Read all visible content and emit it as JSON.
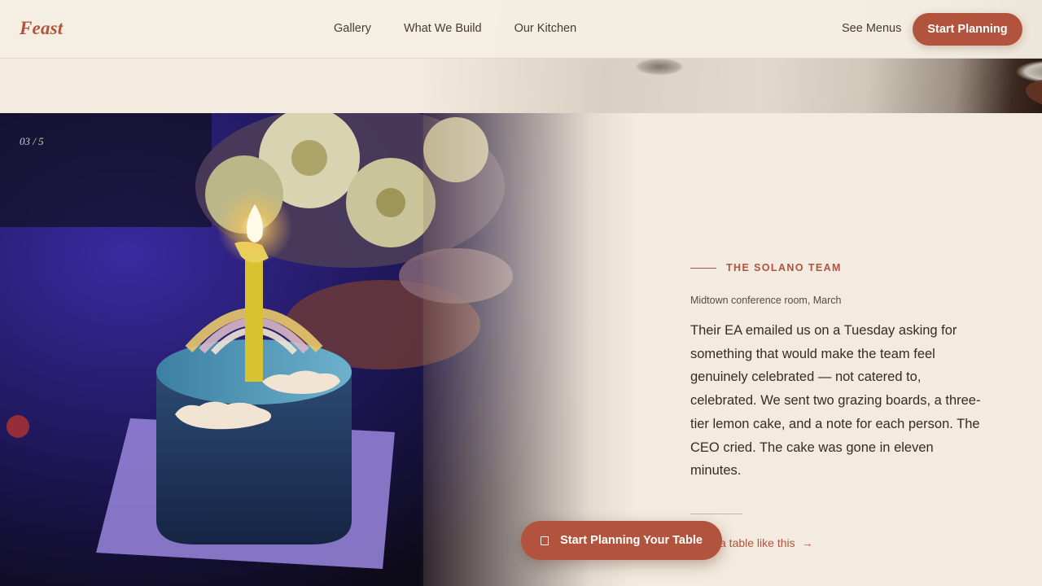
{
  "header": {
    "logo": "Feast",
    "nav": [
      "Gallery",
      "What We Build",
      "Our Kitchen"
    ],
    "see_menus": "See Menus",
    "cta": "Start Planning"
  },
  "slide": {
    "counter": "03 / 5",
    "eyebrow": "THE SOLANO TEAM",
    "meta": "Midtown conference room, March",
    "story": "Their EA emailed us on a Tuesday asking for something that would make the team feel genuinely celebrated — not catered to, celebrated. We sent two grazing boards, a three-tier lemon cake, and a note for each person. The CEO cried. The cake was gone in eleven minutes.",
    "link": "a table like this",
    "link_arrow": "→"
  },
  "floating_cta": {
    "label": "Start Planning Your Table",
    "icon": "calendar-icon"
  },
  "colors": {
    "accent": "#b2533d",
    "background": "#f3ebdf",
    "text": "#3a2a22"
  }
}
